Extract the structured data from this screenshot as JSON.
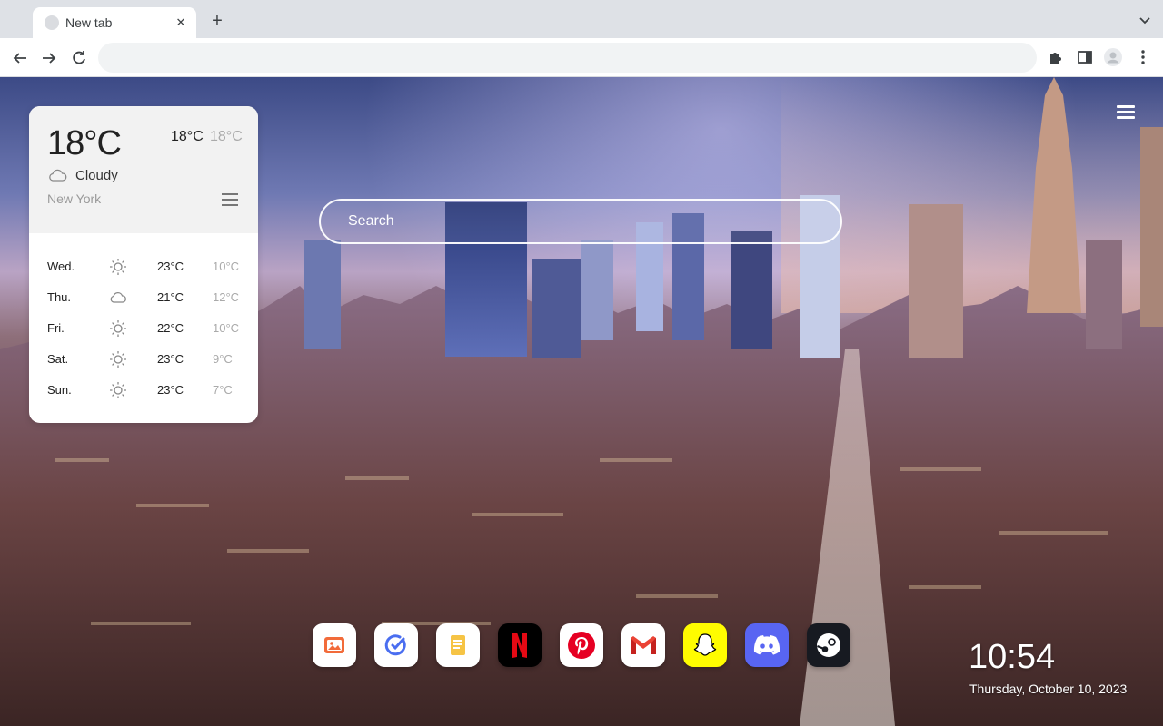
{
  "browser": {
    "tab": {
      "title": "New tab"
    },
    "address": {
      "value": ""
    }
  },
  "weather": {
    "current_temp": "18°C",
    "high": "18°C",
    "low": "18°C",
    "condition": "Cloudy",
    "city": "New York",
    "forecast": [
      {
        "day": "Wed.",
        "icon": "sun-icon",
        "high": "23°C",
        "low": "10°C"
      },
      {
        "day": "Thu.",
        "icon": "cloud-icon",
        "high": "21°C",
        "low": "12°C"
      },
      {
        "day": "Fri.",
        "icon": "sun-icon",
        "high": "22°C",
        "low": "10°C"
      },
      {
        "day": "Sat.",
        "icon": "sun-icon",
        "high": "23°C",
        "low": "9°C"
      },
      {
        "day": "Sun.",
        "icon": "sun-icon",
        "high": "23°C",
        "low": "7°C"
      }
    ]
  },
  "search": {
    "placeholder": "Search"
  },
  "dock": [
    {
      "name": "photos",
      "icon": "photos-icon",
      "color": "#ffffff"
    },
    {
      "name": "tasks",
      "icon": "check-circle-icon",
      "color": "#ffffff"
    },
    {
      "name": "notes",
      "icon": "notes-icon",
      "color": "#ffffff"
    },
    {
      "name": "netflix",
      "icon": "netflix-icon",
      "color": "#000000"
    },
    {
      "name": "pinterest",
      "icon": "pinterest-icon",
      "color": "#ffffff"
    },
    {
      "name": "gmail",
      "icon": "gmail-icon",
      "color": "#ffffff"
    },
    {
      "name": "snapchat",
      "icon": "snapchat-icon",
      "color": "#fffc00"
    },
    {
      "name": "discord",
      "icon": "discord-icon",
      "color": "#5865f2"
    },
    {
      "name": "steam",
      "icon": "steam-icon",
      "color": "#171a21"
    }
  ],
  "clock": {
    "time": "10:54",
    "date": "Thursday, October 10, 2023"
  }
}
